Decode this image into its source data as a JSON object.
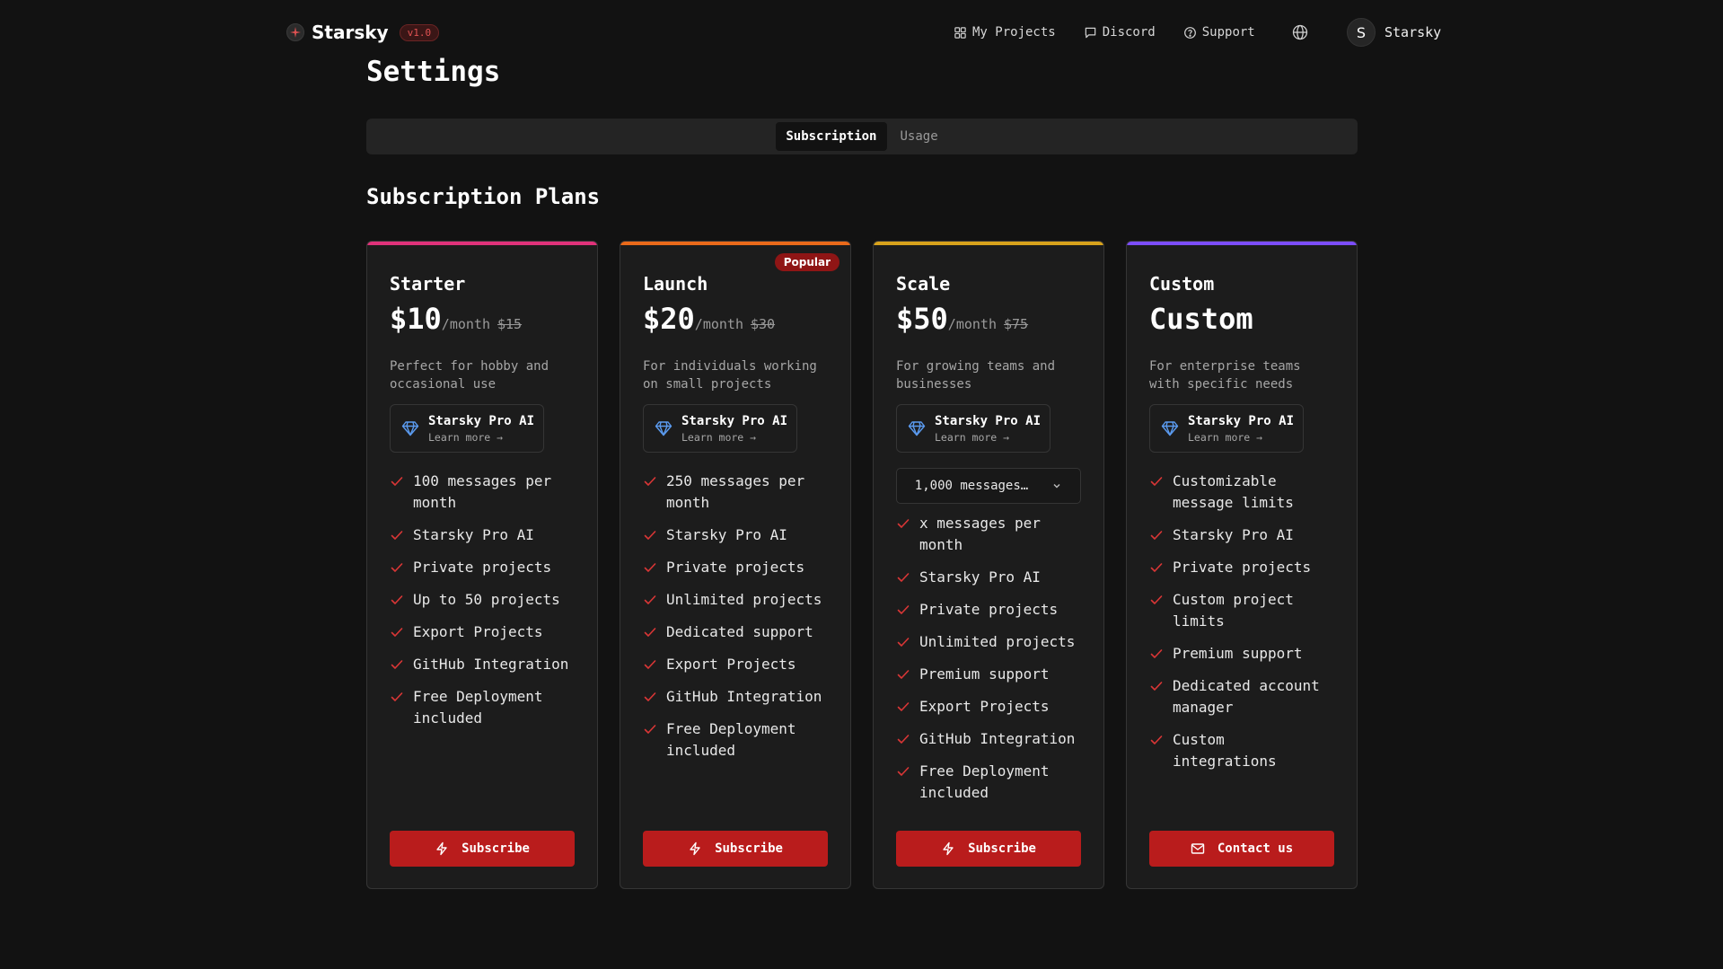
{
  "app": {
    "name": "Starsky",
    "version": "v1.0"
  },
  "nav": {
    "links": [
      {
        "label": "My Projects",
        "icon": "grid-icon"
      },
      {
        "label": "Discord",
        "icon": "message-icon"
      },
      {
        "label": "Support",
        "icon": "help-circle-icon"
      }
    ],
    "globe_icon": "globe-icon",
    "user": {
      "initial": "S",
      "name": "Starsky"
    }
  },
  "page": {
    "title": "Settings",
    "tabs": [
      {
        "label": "Subscription",
        "active": true
      },
      {
        "label": "Usage",
        "active": false
      }
    ],
    "section_title": "Subscription Plans"
  },
  "colors": {
    "accent": "#b91c1c",
    "check": "#d93636",
    "diamond": "#5b9bf0"
  },
  "plans": [
    {
      "name": "Starter",
      "price": "$10",
      "per": "/month",
      "old_price": "$15",
      "description": "Perfect for hobby and occasional use",
      "pro": {
        "title": "Starsky Pro AI",
        "learn": "Learn more →"
      },
      "features": [
        "100 messages per month",
        "Starsky Pro AI",
        "Private projects",
        "Up to 50 projects",
        "Export Projects",
        "GitHub Integration",
        "Free Deployment included"
      ],
      "button": "Subscribe",
      "button_icon": "zap-icon",
      "top_color": "#e0327a"
    },
    {
      "name": "Launch",
      "price": "$20",
      "per": "/month",
      "old_price": "$30",
      "badge": "Popular",
      "description": "For individuals working on small projects",
      "pro": {
        "title": "Starsky Pro AI",
        "learn": "Learn more →"
      },
      "features": [
        "250 messages per month",
        "Starsky Pro AI",
        "Private projects",
        "Unlimited projects",
        "Dedicated support",
        "Export Projects",
        "GitHub Integration",
        "Free Deployment included"
      ],
      "button": "Subscribe",
      "button_icon": "zap-icon",
      "top_color": "#ea6a1a"
    },
    {
      "name": "Scale",
      "price": "$50",
      "per": "/month",
      "old_price": "$75",
      "description": "For growing teams and businesses",
      "pro": {
        "title": "Starsky Pro AI",
        "learn": "Learn more →"
      },
      "messages_select": "1,000 messages…",
      "features": [
        "x messages per month",
        "Starsky Pro AI",
        "Private projects",
        "Unlimited projects",
        "Premium support",
        "Export Projects",
        "GitHub Integration",
        "Free Deployment included"
      ],
      "button": "Subscribe",
      "button_icon": "zap-icon",
      "top_color": "#d7a21c"
    },
    {
      "name": "Custom",
      "price": "Custom",
      "description": "For enterprise teams with specific needs",
      "pro": {
        "title": "Starsky Pro AI",
        "learn": "Learn more →"
      },
      "features": [
        "Customizable message limits",
        "Starsky Pro AI",
        "Private projects",
        "Custom project limits",
        "Premium support",
        "Dedicated account manager",
        "Custom integrations"
      ],
      "button": "Contact us",
      "button_icon": "mail-icon",
      "top_color": "#7c4dff"
    }
  ]
}
